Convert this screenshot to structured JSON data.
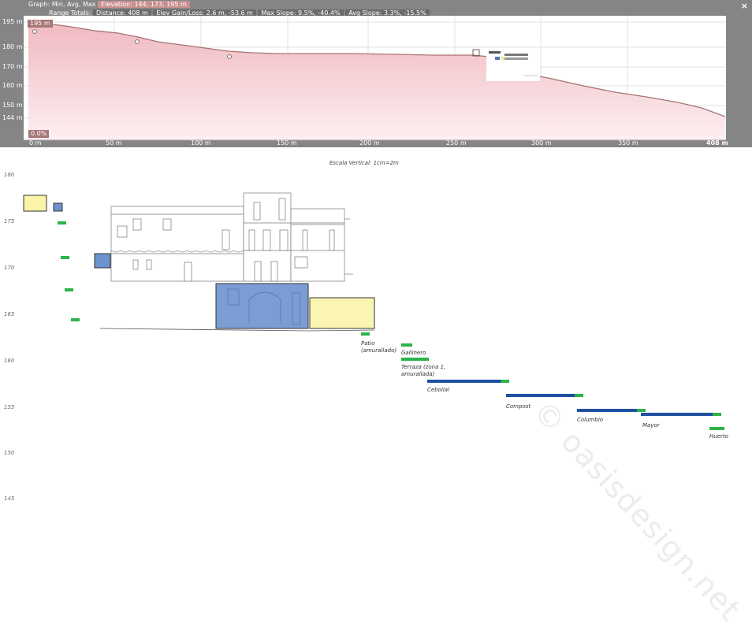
{
  "header": {
    "graph_label": "Graph: Min, Avg, Max",
    "elevation": "Elevation: 144, 173, 195 m",
    "range_totals": "Range Totals:",
    "distance": "Distance: 408 m",
    "elev_gain_loss": "Elev Gain/Loss: 2.6 m, -53.6 m",
    "max_slope": "Max Slope: 9.5%, -40.4%",
    "avg_slope": "Avg Slope: 3.3%, -15.5%",
    "close": "×"
  },
  "profile": {
    "y_labels": [
      "195 m",
      "180 m",
      "170 m",
      "160 m",
      "150 m",
      "144 m"
    ],
    "x_labels": [
      "0 m",
      "50 m",
      "100 m",
      "150 m",
      "200 m",
      "250 m",
      "300 m",
      "350 m",
      "408 m"
    ],
    "top_tag": "195 m",
    "slope_tag": "0.0%",
    "colors": {
      "fill": "#f7d3d7",
      "line": "#a87373",
      "panel": "#858585"
    }
  },
  "section": {
    "scale_note": "Escala Vertical: 1cm=2m",
    "levels": [
      "180",
      "175",
      "170",
      "165",
      "160",
      "155",
      "150",
      "145"
    ],
    "labels": {
      "patio": [
        "Patio",
        "(amurallado)"
      ],
      "gallinero": "Gallinero",
      "terraza": [
        "Terraza (zona 1,",
        "amurallada)"
      ],
      "cebollal": "Cebollal",
      "compost": "Compost",
      "columbio": "Columbio",
      "mayor": "Mayor",
      "huerto": "Huerto"
    },
    "watermark": "© oasisdesign.net",
    "colors": {
      "green": "#2db34a",
      "blue": "#1f4fa0",
      "yellow": "#faf4a8",
      "lightblue": "#6b93cf"
    }
  }
}
